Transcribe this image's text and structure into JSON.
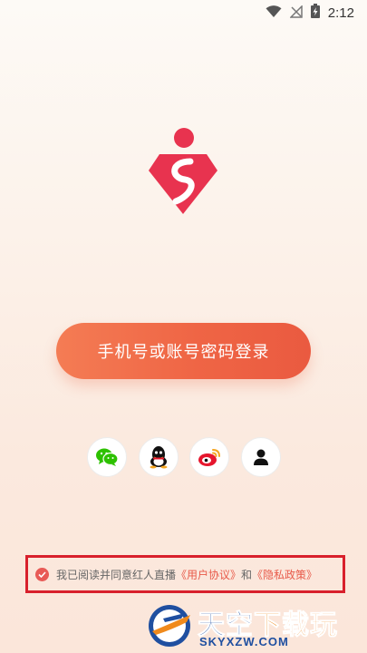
{
  "status_bar": {
    "time": "2:12",
    "icons": [
      "wifi-icon",
      "no-signal-icon",
      "battery-charging-icon"
    ]
  },
  "logo": {
    "icon": "ruby-gem-logo",
    "color": "#e8334f"
  },
  "login_button": {
    "label": "手机号或账号密码登录",
    "gradient": [
      "#f47c54",
      "#ea5a40"
    ]
  },
  "social_login": [
    {
      "name": "wechat",
      "icon": "wechat-icon",
      "color": "#2dc100"
    },
    {
      "name": "qq",
      "icon": "qq-penguin-icon",
      "color": "#111111"
    },
    {
      "name": "weibo",
      "icon": "weibo-icon",
      "color": "#e6162d"
    },
    {
      "name": "account",
      "icon": "user-icon",
      "color": "#111111"
    }
  ],
  "agreement": {
    "prefix": "我已阅读并同意红人直播",
    "user_agreement": "《用户协议》",
    "conjunction": "和",
    "privacy_policy": "《隐私政策》",
    "checked": true,
    "highlight_color": "#d8202c"
  },
  "watermark": {
    "title_main": "天空",
    "title_accent": "下载玩",
    "url": "SKYXZW.COM"
  }
}
